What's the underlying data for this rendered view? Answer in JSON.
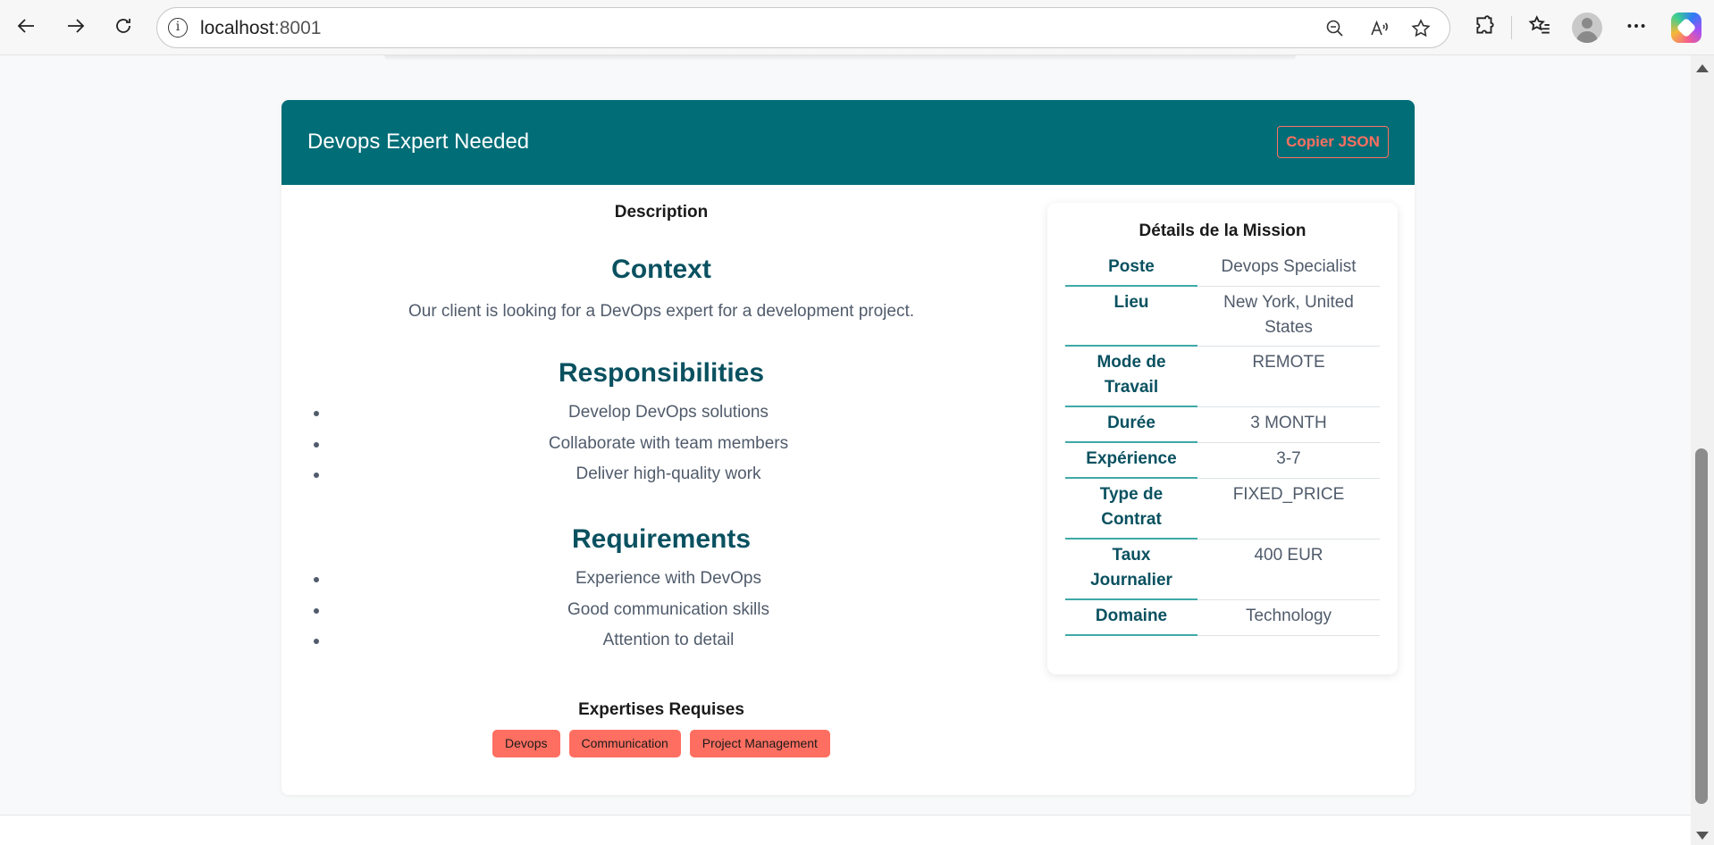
{
  "browser": {
    "url_host": "localhost",
    "url_port": ":8001"
  },
  "mission": {
    "title": "Devops Expert Needed",
    "copy_label": "Copier JSON",
    "description_heading": "Description",
    "context": {
      "heading": "Context",
      "text": "Our client is looking for a DevOps expert for a development project."
    },
    "responsibilities": {
      "heading": "Responsibilities",
      "items": [
        "Develop DevOps solutions",
        "Collaborate with team members",
        "Deliver high-quality work"
      ]
    },
    "requirements": {
      "heading": "Requirements",
      "items": [
        "Experience with DevOps",
        "Good communication skills",
        "Attention to detail"
      ]
    },
    "expertises": {
      "heading": "Expertises Requises",
      "tags": [
        "Devops",
        "Communication",
        "Project Management"
      ]
    },
    "details": {
      "heading": "Détails de la Mission",
      "rows": [
        {
          "label": "Poste",
          "value": "Devops Specialist"
        },
        {
          "label": "Lieu",
          "value": "New York, United States"
        },
        {
          "label": "Mode de Travail",
          "value": "REMOTE"
        },
        {
          "label": "Durée",
          "value": "3 MONTH"
        },
        {
          "label": "Expérience",
          "value": "3-7"
        },
        {
          "label": "Type de Contrat",
          "value": "FIXED_PRICE"
        },
        {
          "label": "Taux Journalier",
          "value": "400 EUR"
        },
        {
          "label": "Domaine",
          "value": "Technology"
        }
      ]
    }
  },
  "colors": {
    "header": "#006d77",
    "accent": "#ff6f61",
    "heading_text": "#0a5160"
  },
  "icons": [
    "back-icon",
    "forward-icon",
    "refresh-icon",
    "info-icon",
    "zoom-out-icon",
    "read-aloud-icon",
    "favorite-star-icon",
    "extensions-icon",
    "favorites-list-icon",
    "profile-avatar-icon",
    "more-icon",
    "copilot-icon"
  ]
}
